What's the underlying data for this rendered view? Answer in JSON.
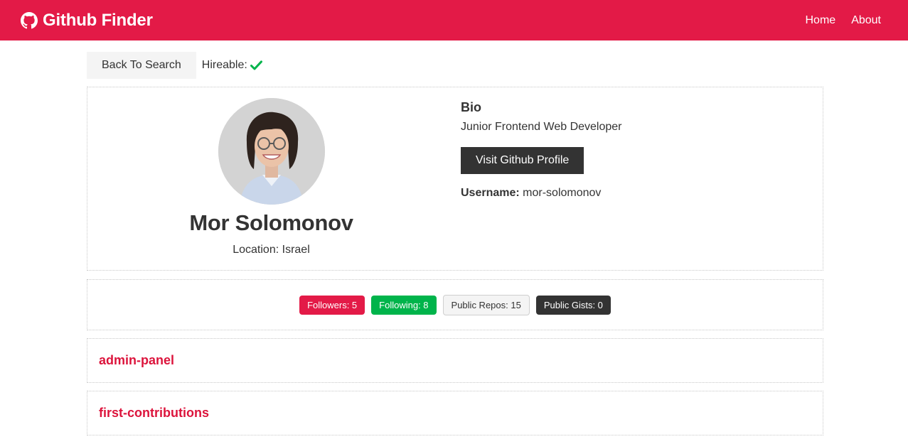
{
  "navbar": {
    "brand_icon": "github-icon",
    "title": "Github Finder",
    "links": [
      {
        "label": "Home"
      },
      {
        "label": "About"
      }
    ],
    "color": "#e31a47"
  },
  "topbar": {
    "back_label": "Back To Search",
    "hireable_label": "Hireable:",
    "hireable_icon": "check-icon",
    "hireable_color": "#00b44b"
  },
  "profile": {
    "name": "Mor Solomonov",
    "location": "Location: Israel",
    "bio_heading": "Bio",
    "bio": "Junior Frontend Web Developer",
    "visit_label": "Visit Github Profile",
    "username_label": "Username:",
    "username": "mor-solomonov"
  },
  "stats": {
    "followers": "Followers: 5",
    "following": "Following: 8",
    "public_repos": "Public Repos: 15",
    "public_gists": "Public Gists: 0"
  },
  "repos": [
    {
      "name": "admin-panel"
    },
    {
      "name": "first-contributions"
    }
  ]
}
